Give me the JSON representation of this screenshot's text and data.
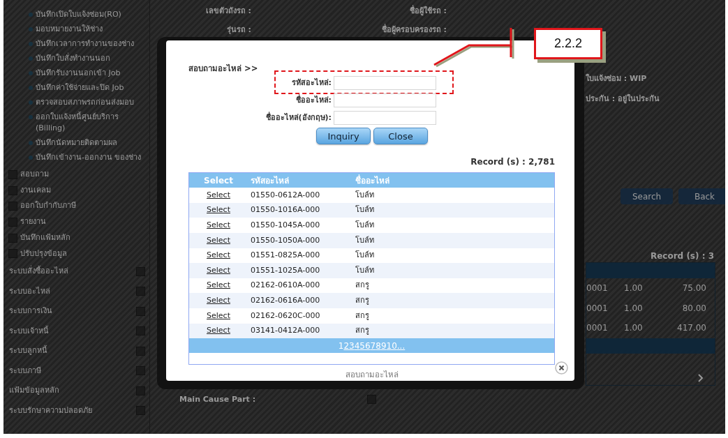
{
  "background_page": {
    "sidebar": {
      "service_items": [
        "บันทึกเปิดใบแจ้งซ่อม(RO)",
        "มอบหมายงานให้ช่าง",
        "บันทึกเวลาการทำงานของช่าง",
        "บันทึกใบสั่งทำงานนอก",
        "บันทึกรับงานนอกเข้า Job",
        "บันทึกค่าใช้จ่ายและปิด Job",
        "ตรวจสอบสภาพรถก่อนส่งมอบ",
        "ออกใบแจ้งหนี้ศูนย์บริการ (Billing)",
        "บันทึกนัดหมายติดตามผล",
        "บันทึกเข้างาน-ออกงาน ของช่าง"
      ],
      "menu_groups": [
        "สอบถาม",
        "งานเคลม",
        "ออกใบกำกับภาษี",
        "รายงาน",
        "บันทึกแฟ้มหลัก",
        "ปรับปรุงข้อมูล"
      ],
      "systems": [
        "ระบบสั่งซื้ออะไหล่",
        "ระบบอะไหล่",
        "ระบบการเงิน",
        "ระบบเจ้าหนี้",
        "ระบบลูกหนี้",
        "ระบบภาษี",
        "แฟ้มข้อมูลหลัก",
        "ระบบรักษาความปลอดภัย"
      ]
    },
    "vehicle_info": [
      {
        "label": "เลขตัวถังรถ :"
      },
      {
        "label": "ชื่อผู้ใช้รถ :"
      },
      {
        "label": "รุ่นรถ :"
      },
      {
        "label": "ชื่อผู้ครอบครองรถ :"
      }
    ],
    "status_lines": [
      "ใบแจ้งซ่อม : WIP",
      "ประกัน : อยู่ในประกัน"
    ],
    "buttons": [
      "Search",
      "Back"
    ],
    "record_count": "Record (s) : 3",
    "table_rows": [
      {
        "column_1": "0001",
        "column_2": "1.00",
        "column_3": "75.00"
      },
      {
        "column_1": "0001",
        "column_2": "1.00",
        "column_3": "80.00"
      },
      {
        "column_1": "0001",
        "column_2": "1.00",
        "column_3": "417.00"
      }
    ],
    "main_cause_label": "Main Cause Part :"
  },
  "dialog": {
    "title": "สอบถามอะไหล่ >>",
    "fields": [
      {
        "label": "รหัสอะไหล่:",
        "highlighted": true
      },
      {
        "label": "ชื่ออะไหล่:",
        "highlighted": false
      },
      {
        "label": "ชื่ออะไหล่(อังกฤษ):",
        "highlighted": false
      }
    ],
    "buttons": [
      "Inquiry",
      "Close"
    ],
    "record_count": "Record (s) : 2,781",
    "columns": [
      "Select",
      "รหัสอะไหล่",
      "ชื่ออะไหล่"
    ],
    "rows": [
      {
        "action": "Select",
        "code": "01550-0612A-000",
        "name": "โบล์ท"
      },
      {
        "action": "Select",
        "code": "01550-1016A-000",
        "name": "โบล์ท"
      },
      {
        "action": "Select",
        "code": "01550-1045A-000",
        "name": "โบล์ท"
      },
      {
        "action": "Select",
        "code": "01550-1050A-000",
        "name": "โบล์ท"
      },
      {
        "action": "Select",
        "code": "01551-0825A-000",
        "name": "โบล์ท"
      },
      {
        "action": "Select",
        "code": "01551-1025A-000",
        "name": "โบล์ท"
      },
      {
        "action": "Select",
        "code": "02162-0610A-000",
        "name": "สกรู"
      },
      {
        "action": "Select",
        "code": "02162-0616A-000",
        "name": "สกรู"
      },
      {
        "action": "Select",
        "code": "02162-0620C-000",
        "name": "สกรู"
      },
      {
        "action": "Select",
        "code": "03141-0412A-000",
        "name": "สกรู"
      }
    ],
    "pages": [
      {
        "label": "1",
        "selected": true
      },
      {
        "label": "2",
        "selected": false
      },
      {
        "label": "3",
        "selected": false
      },
      {
        "label": "4",
        "selected": false
      },
      {
        "label": "5",
        "selected": false
      },
      {
        "label": "6",
        "selected": false
      },
      {
        "label": "7",
        "selected": false
      },
      {
        "label": "8",
        "selected": false
      },
      {
        "label": "9",
        "selected": false
      },
      {
        "label": "10",
        "selected": false
      },
      {
        "label": "...",
        "selected": false
      }
    ],
    "footer": "สอบถามอะไหล่"
  },
  "callout": {
    "label": "2.2.2"
  }
}
